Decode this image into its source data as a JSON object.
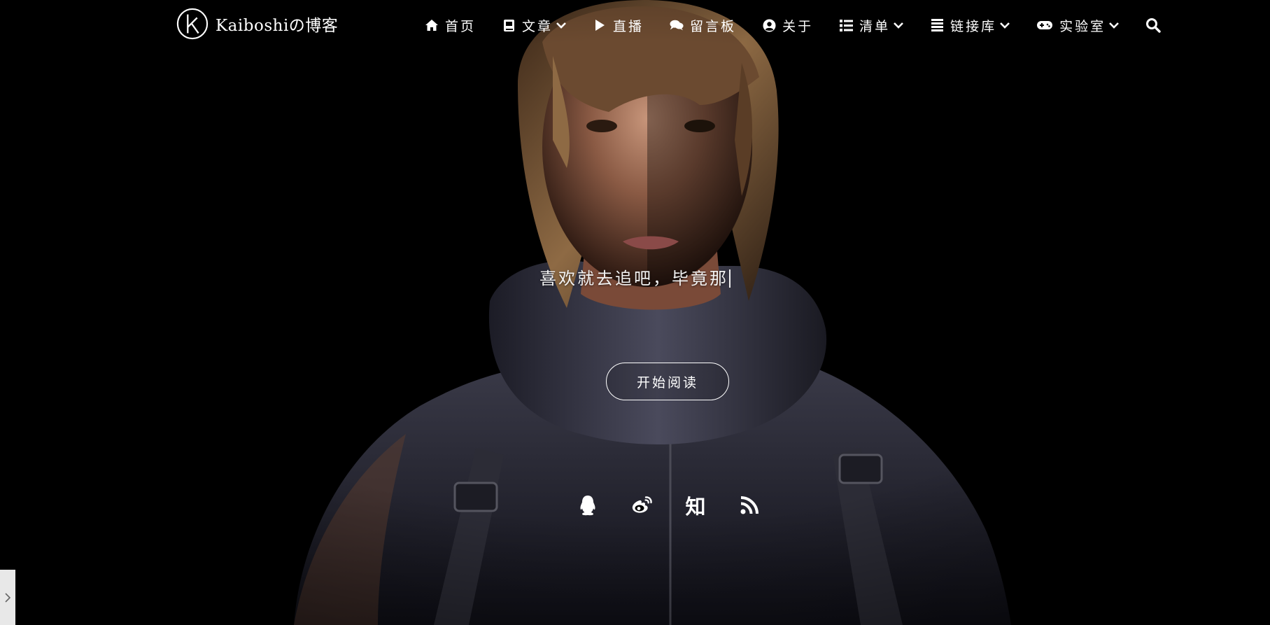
{
  "header": {
    "logo_text": "Kaiboshiの博客",
    "logo_icon": "k-circle-logo-icon",
    "nav": [
      {
        "label": "首页",
        "icon": "home-icon",
        "dropdown": false
      },
      {
        "label": "文章",
        "icon": "book-icon",
        "dropdown": true
      },
      {
        "label": "直播",
        "icon": "play-icon",
        "dropdown": false
      },
      {
        "label": "留言板",
        "icon": "comments-icon",
        "dropdown": false
      },
      {
        "label": "关于",
        "icon": "user-circle-icon",
        "dropdown": false
      },
      {
        "label": "清单",
        "icon": "list-icon",
        "dropdown": true
      },
      {
        "label": "链接库",
        "icon": "list-lines-icon",
        "dropdown": true
      },
      {
        "label": "实验室",
        "icon": "gamepad-icon",
        "dropdown": true
      }
    ],
    "search_icon": "search-icon"
  },
  "hero": {
    "tagline": "喜欢就去追吧，毕竟那",
    "read_button": "开始阅读",
    "social": [
      {
        "icon": "qq-icon"
      },
      {
        "icon": "weibo-icon"
      },
      {
        "icon": "zhihu-icon",
        "label": "知"
      },
      {
        "icon": "rss-icon"
      }
    ]
  },
  "side_tab": {
    "icon": "chevron-right-icon"
  },
  "colors": {
    "background": "#000000",
    "text": "#ffffff",
    "side_tab": "#e8e8e8"
  }
}
